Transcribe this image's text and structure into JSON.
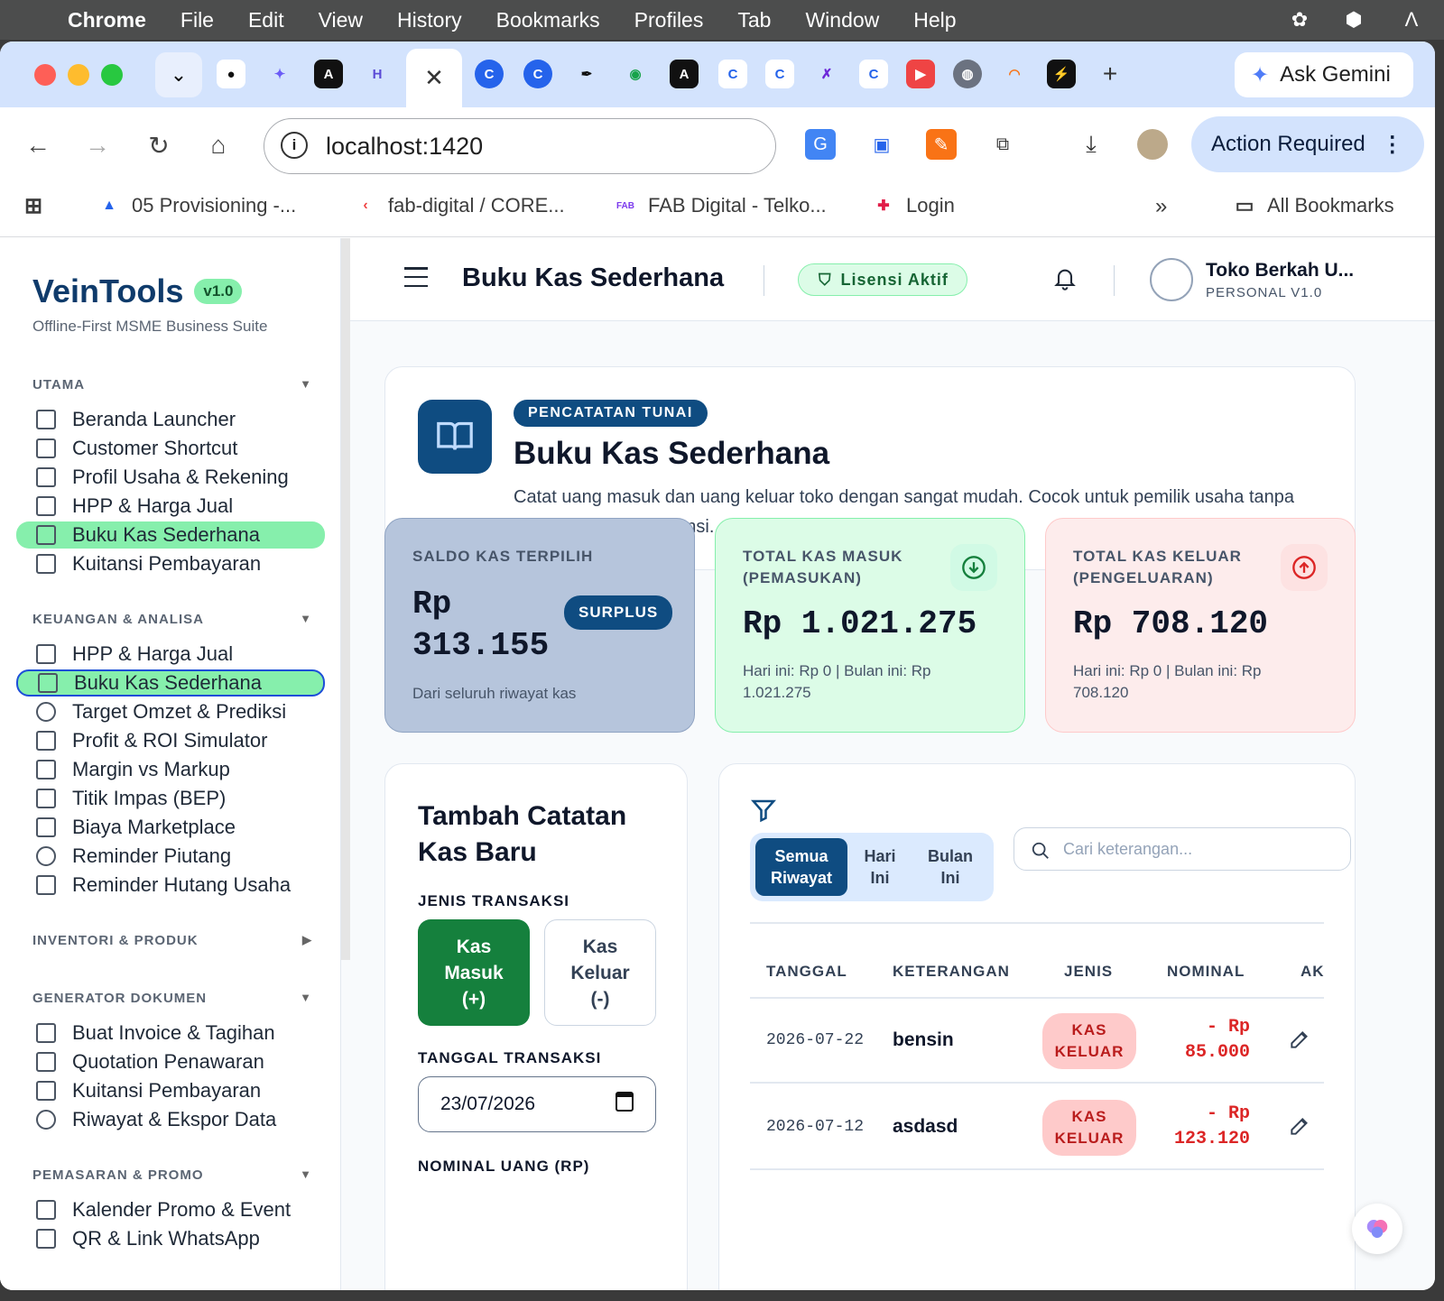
{
  "menubar": {
    "app": "Chrome",
    "items": [
      "File",
      "Edit",
      "View",
      "History",
      "Bookmarks",
      "Profiles",
      "Tab",
      "Window",
      "Help"
    ]
  },
  "browser": {
    "gemini_label": "Ask Gemini",
    "url": "localhost:1420",
    "action_label": "Action Required",
    "bookmarks": [
      "05 Provisioning -...",
      "fab-digital / CORE...",
      "FAB Digital - Telko...",
      "Login"
    ],
    "all_bookmarks": "All Bookmarks"
  },
  "sidebar": {
    "brand": "VeinTools",
    "version": "v1.0",
    "tagline": "Offline-First MSME Business Suite",
    "sections": [
      {
        "title": "UTAMA",
        "expanded": true,
        "items": [
          "Beranda Launcher",
          "Customer Shortcut",
          "Profil Usaha & Rekening",
          "HPP & Harga Jual",
          "Buku Kas Sederhana",
          "Kuitansi Pembayaran"
        ]
      },
      {
        "title": "KEUANGAN & ANALISA",
        "expanded": true,
        "items": [
          "HPP & Harga Jual",
          "Buku Kas Sederhana",
          "Target Omzet & Prediksi",
          "Profit & ROI Simulator",
          "Margin vs Markup",
          "Titik Impas (BEP)",
          "Biaya Marketplace",
          "Reminder Piutang",
          "Reminder Hutang Usaha"
        ]
      },
      {
        "title": "INVENTORI & PRODUK",
        "expanded": false,
        "items": []
      },
      {
        "title": "GENERATOR DOKUMEN",
        "expanded": true,
        "items": [
          "Buat Invoice & Tagihan",
          "Quotation Penawaran",
          "Kuitansi Pembayaran",
          "Riwayat & Ekspor Data"
        ]
      },
      {
        "title": "PEMASARAN & PROMO",
        "expanded": true,
        "items": [
          "Kalender Promo & Event",
          "QR & Link WhatsApp"
        ]
      }
    ]
  },
  "topbar": {
    "title": "Buku Kas Sederhana",
    "license": "Lisensi Aktif",
    "user_name": "Toko Berkah U...",
    "user_role": "PERSONAL V1.0"
  },
  "hero": {
    "pill": "PENCATATAN TUNAI",
    "title": "Buku Kas Sederhana",
    "description": "Catat uang masuk dan uang keluar toko dengan sangat mudah. Cocok untuk pemilik usaha tanpa latar belakang akuntansi."
  },
  "stats": {
    "saldo": {
      "label": "SALDO KAS TERPILIH",
      "value_line1": "Rp",
      "value_line2": "313.155",
      "badge": "SURPLUS",
      "sub": "Dari seluruh riwayat kas"
    },
    "masuk": {
      "label_line1": "TOTAL KAS MASUK",
      "label_line2": "(PEMASUKAN)",
      "value": "Rp 1.021.275",
      "sub_line1": "Hari ini: Rp 0 | Bulan ini: Rp",
      "sub_line2": "1.021.275"
    },
    "keluar": {
      "label_line1": "TOTAL KAS KELUAR",
      "label_line2": "(PENGELUARAN)",
      "value": "Rp 708.120",
      "sub_line1": "Hari ini: Rp 0 | Bulan ini: Rp",
      "sub_line2": "708.120"
    }
  },
  "form": {
    "title_line1": "Tambah Catatan",
    "title_line2": "Kas Baru",
    "jenis_label": "JENIS TRANSAKSI",
    "btn_masuk": [
      "Kas",
      "Masuk",
      "(+)"
    ],
    "btn_keluar": [
      "Kas",
      "Keluar",
      "(-)"
    ],
    "tanggal_label": "TANGGAL TRANSAKSI",
    "tanggal_value": "23/07/2026",
    "nominal_label": "NOMINAL UANG (RP)"
  },
  "history": {
    "filters": [
      [
        "Semua",
        "Riwayat"
      ],
      [
        "Hari",
        "Ini"
      ],
      [
        "Bulan",
        "Ini"
      ]
    ],
    "search_placeholder": "Cari keterangan...",
    "columns": [
      "TANGGAL",
      "KETERANGAN",
      "JENIS",
      "NOMINAL",
      "AK"
    ],
    "rows": [
      {
        "date": "2026-07-22",
        "desc": "bensin",
        "type_line1": "KAS",
        "type_line2": "KELUAR",
        "amount_line1": "- Rp",
        "amount_line2": "85.000"
      },
      {
        "date": "2026-07-12",
        "desc": "asdasd",
        "type_line1": "KAS",
        "type_line2": "KELUAR",
        "amount_line1": "- Rp",
        "amount_line2": "123.120"
      }
    ]
  },
  "colors": {
    "primary": "#0f4c81",
    "active_nav": "#86efac",
    "income": "#15803d",
    "expense": "#dc2626"
  }
}
